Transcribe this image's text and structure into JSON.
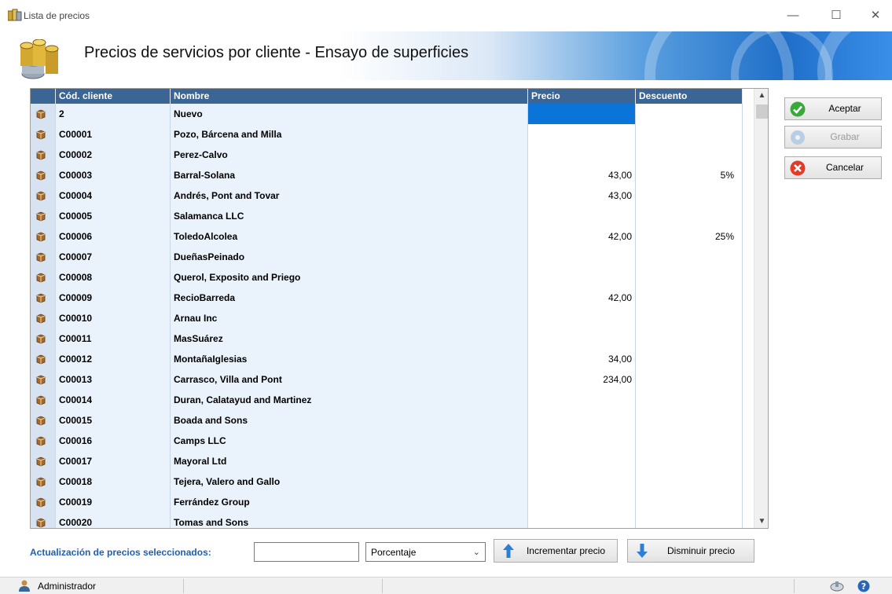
{
  "window": {
    "title": "Lista de precios",
    "minimize": "—",
    "maximize": "☐",
    "close": "✕"
  },
  "header": {
    "title": "Precios de servicios por cliente - Ensayo de superficies"
  },
  "grid": {
    "columns": [
      "Cód. cliente",
      "Nombre",
      "Precio",
      "Descuento"
    ],
    "rows": [
      {
        "code": "2",
        "name": "Nuevo",
        "price": "",
        "discount": ""
      },
      {
        "code": "C00001",
        "name": "Pozo, Bárcena and Milla",
        "price": "",
        "discount": ""
      },
      {
        "code": "C00002",
        "name": "Perez-Calvo",
        "price": "",
        "discount": ""
      },
      {
        "code": "C00003",
        "name": "Barral-Solana",
        "price": "43,00",
        "discount": "5%"
      },
      {
        "code": "C00004",
        "name": "Andrés, Pont and Tovar",
        "price": "43,00",
        "discount": ""
      },
      {
        "code": "C00005",
        "name": "Salamanca LLC",
        "price": "",
        "discount": ""
      },
      {
        "code": "C00006",
        "name": "ToledoAlcolea",
        "price": "42,00",
        "discount": "25%"
      },
      {
        "code": "C00007",
        "name": "DueñasPeinado",
        "price": "",
        "discount": ""
      },
      {
        "code": "C00008",
        "name": "Querol, Exposito and Priego",
        "price": "",
        "discount": ""
      },
      {
        "code": "C00009",
        "name": "RecioBarreda",
        "price": "42,00",
        "discount": ""
      },
      {
        "code": "C00010",
        "name": "Arnau Inc",
        "price": "",
        "discount": ""
      },
      {
        "code": "C00011",
        "name": "MasSuárez",
        "price": "",
        "discount": ""
      },
      {
        "code": "C00012",
        "name": "MontañaIglesias",
        "price": "34,00",
        "discount": ""
      },
      {
        "code": "C00013",
        "name": "Carrasco, Villa and Pont",
        "price": "234,00",
        "discount": ""
      },
      {
        "code": "C00014",
        "name": "Duran, Calatayud and Martinez",
        "price": "",
        "discount": ""
      },
      {
        "code": "C00015",
        "name": "Boada and Sons",
        "price": "",
        "discount": ""
      },
      {
        "code": "C00016",
        "name": "Camps LLC",
        "price": "",
        "discount": ""
      },
      {
        "code": "C00017",
        "name": "Mayoral Ltd",
        "price": "",
        "discount": ""
      },
      {
        "code": "C00018",
        "name": "Tejera, Valero and Gallo",
        "price": "",
        "discount": ""
      },
      {
        "code": "C00019",
        "name": "Ferrández Group",
        "price": "",
        "discount": ""
      },
      {
        "code": "C00020",
        "name": "Tomas and Sons",
        "price": "",
        "discount": ""
      }
    ],
    "selected_price_row": 0
  },
  "actions": {
    "accept": "Aceptar",
    "save": "Grabar",
    "cancel": "Cancelar"
  },
  "update": {
    "label": "Actualización de precios seleccionados:",
    "value": "",
    "mode": "Porcentaje",
    "increase": "Incrementar precio",
    "decrease": "Disminuir precio"
  },
  "status": {
    "user": "Administrador"
  },
  "colors": {
    "header_bg": "#3a6595",
    "selection": "#0a74d8",
    "label_blue": "#1f5fb3"
  }
}
